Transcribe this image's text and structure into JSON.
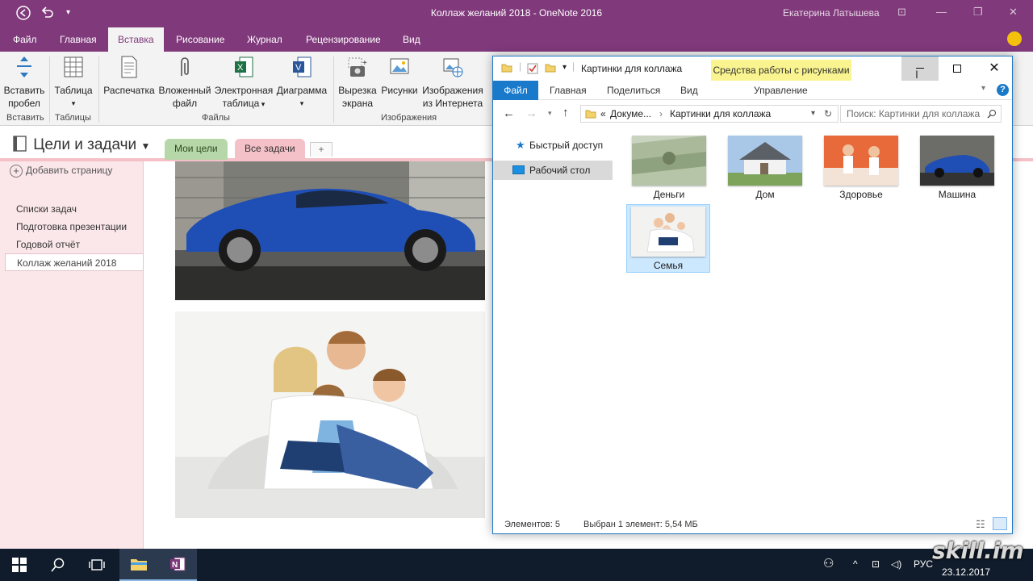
{
  "window": {
    "title": "Коллаж желаний 2018  -  OneNote 2016",
    "user": "Екатерина Латышева"
  },
  "menu": [
    "Файл",
    "Главная",
    "Вставка",
    "Рисование",
    "Журнал",
    "Рецензирование",
    "Вид"
  ],
  "ribbon": {
    "insert_space": [
      "Вставить",
      "пробел"
    ],
    "table": "Таблица",
    "printout": "Распечатка",
    "attached_file": [
      "Вложенный",
      "файл"
    ],
    "spreadsheet": [
      "Электронная",
      "таблица"
    ],
    "diagram": "Диаграмма",
    "screen_clip": [
      "Вырезка",
      "экрана"
    ],
    "pictures": "Рисунки",
    "online_pictures": [
      "Изображения",
      "из Интернета"
    ],
    "groups": [
      "Вставить",
      "Таблицы",
      "Файлы",
      "Изображения"
    ]
  },
  "notebook": {
    "title": "Цели и задачи",
    "sections": [
      "Мои цели",
      "Все задачи"
    ],
    "add_tab": "+"
  },
  "pages": {
    "add_page": "Добавить страницу",
    "items": [
      "Списки задач",
      "Подготовка презентации",
      "Годовой отчёт",
      "Коллаж желаний 2018"
    ]
  },
  "explorer": {
    "title": "Картинки для коллажа",
    "context_tab": "Средства работы с рисунками",
    "tabs": [
      "Файл",
      "Главная",
      "Поделиться",
      "Вид",
      "Управление"
    ],
    "address": [
      "«",
      "Докуме...",
      "›",
      "Картинки для коллажа"
    ],
    "search_placeholder": "Поиск: Картинки для коллажа",
    "nav": [
      "Быстрый доступ",
      "Рабочий стол"
    ],
    "files": [
      "Деньги",
      "Дом",
      "Здоровье",
      "Машина",
      "Семья"
    ],
    "status_count": "Элементов: 5",
    "status_selected": "Выбран 1 элемент: 5,54 МБ"
  },
  "taskbar": {
    "lang": "РУС",
    "date": "23.12.2017"
  },
  "watermark": "skill.im",
  "colors": {
    "onenote_purple": "#80397b",
    "section_green": "#b6d7a8",
    "section_pink": "#f4c1c8",
    "explorer_blue": "#1979ca",
    "context_yellow": "#f9f48f"
  }
}
